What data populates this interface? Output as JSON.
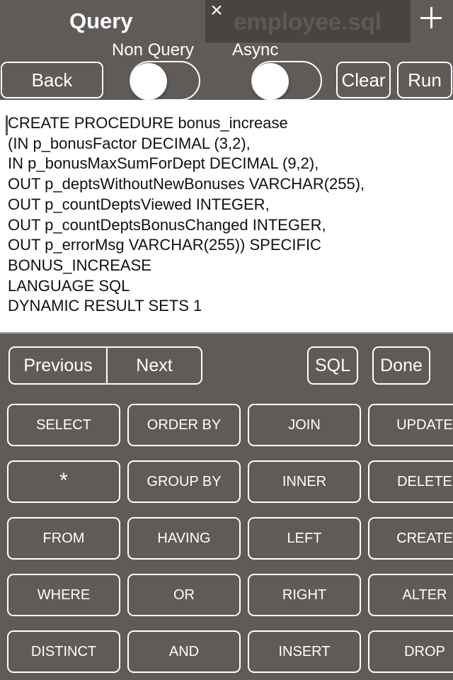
{
  "header": {
    "title": "Query",
    "tab": {
      "label": "employee.sql",
      "close_icon": "close-icon"
    },
    "add_tab_icon": "plus-icon",
    "toggles": [
      {
        "label": "Non Query",
        "on": false
      },
      {
        "label": "Async",
        "on": false
      }
    ],
    "buttons": {
      "back": "Back",
      "clear": "Clear",
      "run": "Run"
    }
  },
  "editor": {
    "lines": [
      "CREATE PROCEDURE bonus_increase",
      "(IN p_bonusFactor DECIMAL (3,2),",
      "IN p_bonusMaxSumForDept DECIMAL (9,2),",
      "OUT p_deptsWithoutNewBonuses VARCHAR(255),",
      "OUT p_countDeptsViewed INTEGER,",
      "OUT p_countDeptsBonusChanged INTEGER,",
      "OUT p_errorMsg VARCHAR(255)) SPECIFIC",
      "BONUS_INCREASE",
      "LANGUAGE SQL",
      "DYNAMIC RESULT SETS 1"
    ]
  },
  "accessory": {
    "previous": "Previous",
    "next": "Next",
    "sql": "SQL",
    "done": "Done"
  },
  "keywords": [
    [
      "SELECT",
      "ORDER BY",
      "JOIN",
      "UPDATE"
    ],
    [
      "*",
      "GROUP BY",
      "INNER",
      "DELETE"
    ],
    [
      "FROM",
      "HAVING",
      "LEFT",
      "CREATE"
    ],
    [
      "WHERE",
      "OR",
      "RIGHT",
      "ALTER"
    ],
    [
      "DISTINCT",
      "AND",
      "INSERT",
      "DROP"
    ]
  ]
}
